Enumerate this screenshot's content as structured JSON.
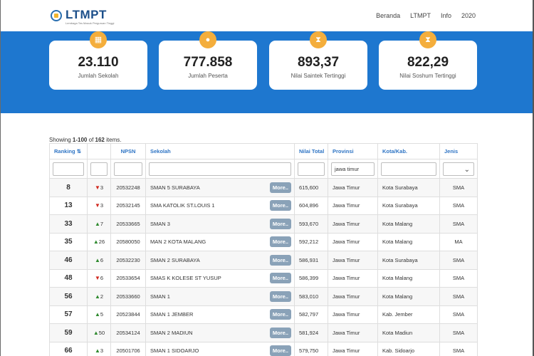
{
  "brand": {
    "name": "LTMPT",
    "tagline": "Lembaga Tes Masuk Perguruan Tinggi"
  },
  "nav": [
    "Beranda",
    "LTMPT",
    "Info",
    "2020"
  ],
  "stats": [
    {
      "value": "23.110",
      "label": "Jumlah Sekolah",
      "icon": "building-icon"
    },
    {
      "value": "777.858",
      "label": "Jumlah Peserta",
      "icon": "user-icon"
    },
    {
      "value": "893,37",
      "label": "Nilai Saintek Tertinggi",
      "icon": "trophy-icon"
    },
    {
      "value": "822,29",
      "label": "Nilai Soshum Tertinggi",
      "icon": "trophy-icon"
    }
  ],
  "summary": {
    "prefix": "Showing",
    "range": "1-100",
    "of": "of",
    "total": "162",
    "suffix": "items."
  },
  "columns": [
    "Ranking",
    "",
    "NPSN",
    "Sekolah",
    "Nilai Total",
    "Provinsi",
    "Kota/Kab.",
    "Jenis"
  ],
  "filters": {
    "provinsi": "jawa timur"
  },
  "more_label": "More..",
  "colors": {
    "hero": "#1e77cf",
    "accent": "#f4ae3c",
    "header_text": "#2e74c4",
    "up": "#2f8a2f",
    "down": "#d1281e"
  },
  "rows": [
    {
      "rank": "8",
      "dir": "down",
      "change": "3",
      "npsn": "20532248",
      "school": "SMAN 5 SURABAYA",
      "score": "615,600",
      "province": "Jawa Timur",
      "city": "Kota Surabaya",
      "type": "SMA"
    },
    {
      "rank": "13",
      "dir": "down",
      "change": "3",
      "npsn": "20532145",
      "school": "SMA KATOLIK ST.LOUIS 1",
      "score": "604,896",
      "province": "Jawa Timur",
      "city": "Kota Surabaya",
      "type": "SMA"
    },
    {
      "rank": "33",
      "dir": "up",
      "change": "7",
      "npsn": "20533665",
      "school": "SMAN 3",
      "score": "593,670",
      "province": "Jawa Timur",
      "city": "Kota Malang",
      "type": "SMA"
    },
    {
      "rank": "35",
      "dir": "up",
      "change": "26",
      "npsn": "20580050",
      "school": "MAN 2 KOTA MALANG",
      "score": "592,212",
      "province": "Jawa Timur",
      "city": "Kota Malang",
      "type": "MA"
    },
    {
      "rank": "46",
      "dir": "up",
      "change": "6",
      "npsn": "20532230",
      "school": "SMAN 2 SURABAYA",
      "score": "586,931",
      "province": "Jawa Timur",
      "city": "Kota Surabaya",
      "type": "SMA"
    },
    {
      "rank": "48",
      "dir": "down",
      "change": "6",
      "npsn": "20533654",
      "school": "SMAS K KOLESE ST YUSUP",
      "score": "586,399",
      "province": "Jawa Timur",
      "city": "Kota Malang",
      "type": "SMA"
    },
    {
      "rank": "56",
      "dir": "up",
      "change": "2",
      "npsn": "20533660",
      "school": "SMAN 1",
      "score": "583,010",
      "province": "Jawa Timur",
      "city": "Kota Malang",
      "type": "SMA"
    },
    {
      "rank": "57",
      "dir": "up",
      "change": "5",
      "npsn": "20523844",
      "school": "SMAN 1 JEMBER",
      "score": "582,797",
      "province": "Jawa Timur",
      "city": "Kab. Jember",
      "type": "SMA"
    },
    {
      "rank": "59",
      "dir": "up",
      "change": "50",
      "npsn": "20534124",
      "school": "SMAN 2 MADIUN",
      "score": "581,924",
      "province": "Jawa Timur",
      "city": "Kota Madiun",
      "type": "SMA"
    },
    {
      "rank": "66",
      "dir": "up",
      "change": "3",
      "npsn": "20501706",
      "school": "SMAN 1 SIDOARJO",
      "score": "579,750",
      "province": "Jawa Timur",
      "city": "Kab. Sidoarjo",
      "type": "SMA"
    }
  ]
}
